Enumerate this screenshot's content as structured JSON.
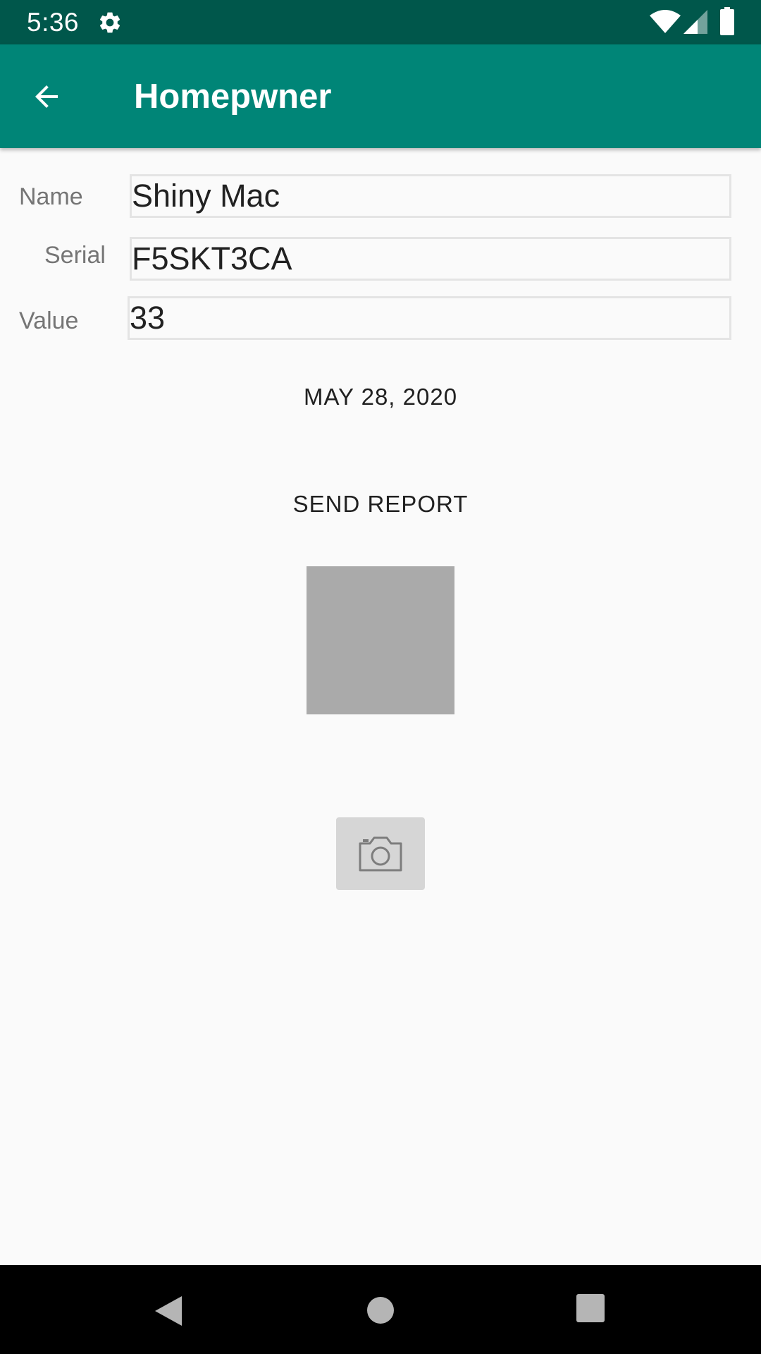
{
  "status_bar": {
    "time": "5:36",
    "icons": [
      "gear-icon",
      "wifi-icon",
      "cell-signal-icon",
      "battery-icon"
    ]
  },
  "app_bar": {
    "title": "Homepwner",
    "back_icon": "arrow-left-icon"
  },
  "form": {
    "name_label": "Name",
    "name_value": "Shiny Mac",
    "serial_label": "Serial",
    "serial_value": "F5SKT3CA",
    "value_label": "Value",
    "value_value": "33"
  },
  "date_button_label": "MAY 28, 2020",
  "report_button_label": "SEND REPORT",
  "camera_button_icon": "camera-icon",
  "nav_bar": {
    "icons": [
      "nav-back-icon",
      "nav-home-icon",
      "nav-recents-icon"
    ]
  },
  "colors": {
    "status_bar": "#00574b",
    "app_bar": "#008577",
    "background": "#fafafa",
    "photo_placeholder": "#aaaaaa",
    "camera_button": "#d6d6d6"
  }
}
